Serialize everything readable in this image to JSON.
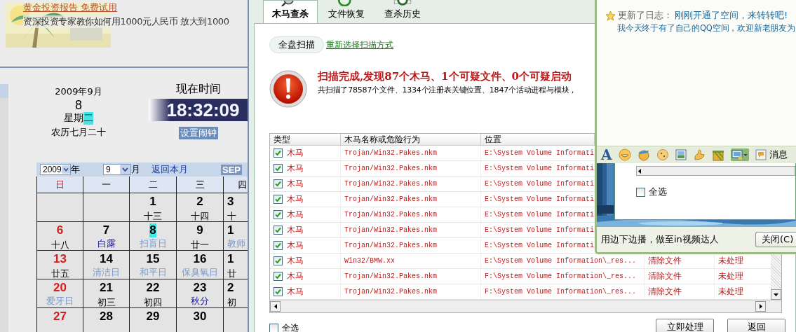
{
  "calendar_page": {
    "ad": {
      "link": "黄金投资报告 免费试用",
      "text": "资深投资专家教你如何用1000元人民币 放大到1000"
    },
    "date": {
      "year_month": "2009年9月",
      "day": "8",
      "weekday_prefix": "星期",
      "weekday": "二",
      "lunar": "农历七月二十"
    },
    "clock": {
      "title": "现在时间",
      "time": "18:32:09",
      "alarm": "设置闹钟"
    },
    "calendar": {
      "year": "2009",
      "year_label": "年",
      "month": "9",
      "month_label": "月",
      "back": "返回本月",
      "month_en": "SEP",
      "weekdays": [
        {
          "label": "日",
          "kind": "sunday"
        },
        {
          "label": "一",
          "kind": "weekday"
        },
        {
          "label": "二",
          "kind": "weekday"
        },
        {
          "label": "三",
          "kind": "weekday"
        },
        {
          "label": "四",
          "kind": "weekday"
        }
      ],
      "weeks": [
        [
          {
            "kind": "blank"
          },
          {
            "kind": "blank"
          },
          {
            "day": "1",
            "sub": "十三",
            "kind": "lunar",
            "today": false
          },
          {
            "day": "2",
            "sub": "十四",
            "kind": "lunar",
            "today": false
          },
          {
            "day": "3",
            "sub": "十",
            "kind": "lunar",
            "today": false
          }
        ],
        [
          {
            "day": "6",
            "sub": "十八",
            "kind": "lunar",
            "today": false
          },
          {
            "day": "7",
            "sub": "白露",
            "kind": "term",
            "today": false
          },
          {
            "day": "8",
            "sub": "扫盲日",
            "kind": "festival",
            "today": true
          },
          {
            "day": "9",
            "sub": "廿一",
            "kind": "lunar",
            "today": false
          },
          {
            "day": "1",
            "sub": "教师",
            "kind": "festival",
            "today": false
          }
        ],
        [
          {
            "day": "13",
            "sub": "廿五",
            "kind": "lunar",
            "today": false
          },
          {
            "day": "14",
            "sub": "清洁日",
            "kind": "festival",
            "today": false
          },
          {
            "day": "15",
            "sub": "和平日",
            "kind": "festival",
            "today": false
          },
          {
            "day": "16",
            "sub": "保臭氧日",
            "kind": "festival",
            "today": false
          },
          {
            "day": "1",
            "sub": "廿",
            "kind": "lunar",
            "today": false
          }
        ],
        [
          {
            "day": "20",
            "sub": "爱牙日",
            "kind": "festival",
            "today": false
          },
          {
            "day": "21",
            "sub": "初三",
            "kind": "lunar",
            "today": false
          },
          {
            "day": "22",
            "sub": "初四",
            "kind": "lunar",
            "today": false
          },
          {
            "day": "23",
            "sub": "秋分",
            "kind": "term",
            "today": false
          },
          {
            "day": "2",
            "sub": "初",
            "kind": "lunar",
            "today": false
          }
        ],
        [
          {
            "day": "27",
            "kind": "lunar",
            "today": false
          },
          {
            "day": "28",
            "kind": "lunar",
            "today": false
          },
          {
            "day": "29",
            "kind": "lunar",
            "today": false
          },
          {
            "day": "30",
            "kind": "lunar",
            "today": false
          },
          {
            "kind": "blank"
          }
        ]
      ]
    }
  },
  "scanner": {
    "tabs": [
      {
        "label": "木马查杀",
        "selected": true
      },
      {
        "label": "文件恢复",
        "selected": false
      },
      {
        "label": "查杀历史",
        "selected": false
      }
    ],
    "scan_mode": "全盘扫描",
    "rescan_link": "重新选择扫描方式",
    "headline": "扫描完成,发现87个木马、1个可疑文件、0个可疑启动",
    "summary": "共扫描了78587个文件、1334个注册表关键位置、1847个活动进程与模块，",
    "table": {
      "columns": [
        "类型",
        "木马名称或危险行为",
        "位置"
      ],
      "rows": [
        {
          "checked": true,
          "type": "木马",
          "name": "Trojan/Win32.Pakes.nkm",
          "location": "E:\\System Volume Informati"
        },
        {
          "checked": true,
          "type": "木马",
          "name": "Trojan/Win32.Pakes.nkm",
          "location": "E:\\System Volume Informati"
        },
        {
          "checked": true,
          "type": "木马",
          "name": "Trojan/Win32.Pakes.nkm",
          "location": "E:\\System Volume Informati"
        },
        {
          "checked": true,
          "type": "木马",
          "name": "Trojan/Win32.Pakes.nkm",
          "location": "E:\\System Volume Informati"
        },
        {
          "checked": true,
          "type": "木马",
          "name": "Trojan/Win32.Pakes.nkm",
          "location": "E:\\System Volume Informati"
        },
        {
          "checked": true,
          "type": "木马",
          "name": "Trojan/Win32.Pakes.nkm",
          "location": "E:\\System Volume Informati"
        },
        {
          "checked": true,
          "type": "木马",
          "name": "Trojan/Win32.Pakes.nkm",
          "location": "E:\\System Volume Informati"
        },
        {
          "checked": true,
          "type": "木马",
          "name": "Win32/BMW.xx",
          "location": "E:\\System Volume Information\\_res...",
          "action": "清除文件",
          "status": "未处理"
        },
        {
          "checked": true,
          "type": "木马",
          "name": "Trojan/Win32.Pakes.nkm",
          "location": "F:\\System Volume Information\\_res...",
          "action": "清除文件",
          "status": "未处理"
        },
        {
          "checked": true,
          "type": "木马",
          "name": "Trojan/Win32.Pakes.nkm",
          "location": "F:\\System Volume Information\\_res...",
          "action": "清除文件",
          "status": "未处理"
        }
      ]
    },
    "select_all": {
      "label": "全选",
      "checked": false
    },
    "buttons": [
      "立即处理",
      "返回"
    ]
  },
  "qq_window": {
    "feed": {
      "prefix": "更新了日志：",
      "link": "刚刚开通了空间，来转转吧!",
      "text": "我今天终于有了自己的QQ空间，欢迎新老朋友为"
    },
    "font_button": "A",
    "toolbar_label": "消息",
    "select_all": {
      "label": "全选",
      "checked": false
    },
    "footer_text": "用边下边播，做至in视频达人",
    "close_button": "关闭(C)"
  }
}
